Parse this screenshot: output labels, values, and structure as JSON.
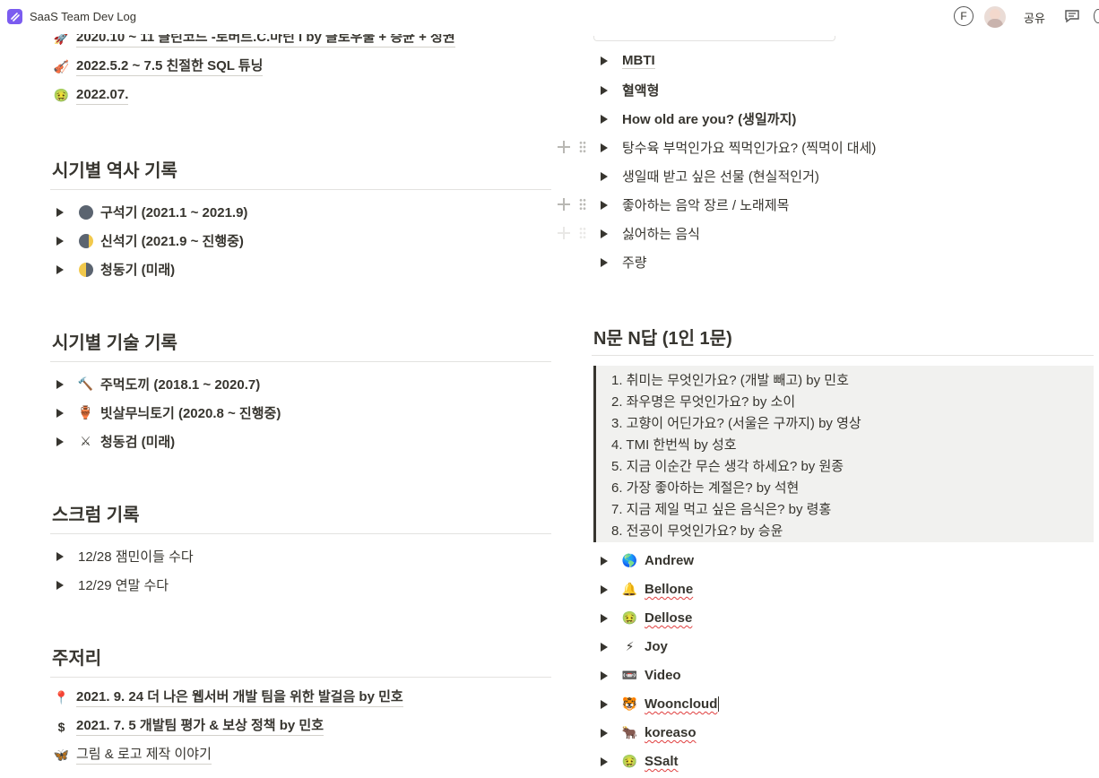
{
  "app": {
    "title": "SaaS Team Dev Log",
    "avatar_letter": "F",
    "share_label": "공유"
  },
  "left": {
    "top_links": [
      {
        "icon": "rocket-icon",
        "text": "2020.10 ~ 11 클린코드 -로버트.C.마틴 l by 클로우불 + 승균 + 정권"
      },
      {
        "icon": "violin-icon",
        "text": "2022.5.2 ~ 7.5 친절한 SQL 튜닝"
      },
      {
        "icon": "sick-face-icon",
        "text": "2022.07."
      }
    ],
    "history": {
      "heading": "시기별 역사 기록",
      "items": [
        {
          "icon": "new-moon-icon",
          "text": "구석기 (2021.1 ~ 2021.9)"
        },
        {
          "icon": "crescent-moon-icon",
          "text": "신석기 (2021.9 ~ 진행중)"
        },
        {
          "icon": "half-moon-icon",
          "text": "청동기 (미래)"
        }
      ]
    },
    "tech": {
      "heading": "시기별 기술 기록",
      "items": [
        {
          "icon": "hammer-icon",
          "text": "주먹도끼 (2018.1 ~ 2020.7)"
        },
        {
          "icon": "pottery-icon",
          "text": "빗살무늬토기 (2020.8 ~ 진행중)"
        },
        {
          "icon": "crossed-swords-icon",
          "text": "청동검 (미래)"
        }
      ]
    },
    "scrum": {
      "heading": "스크럼 기록",
      "items": [
        "12/28 잼민이들 수다",
        "12/29 연말 수다"
      ]
    },
    "ramble": {
      "heading": "주저리",
      "links": [
        {
          "icon": "pushpin-icon",
          "text": "2021. 9. 24 더 나은 웹서버 개발 팀을 위한 발걸음 by 민호"
        },
        {
          "icon": "dollar-icon",
          "text": "2021. 7. 5 개발팀 평가 & 보상 정책 by 민호"
        },
        {
          "icon": "butterfly-icon",
          "text": "그림 & 로고 제작 이야기"
        }
      ]
    }
  },
  "right": {
    "toggles": [
      {
        "text": "MBTI",
        "bold": true,
        "squig": false
      },
      {
        "text": "혈액형",
        "bold": true
      },
      {
        "text": "How old are you? (생일까지)",
        "bold": true
      },
      {
        "text": "탕수육 부먹인가요 찍먹인가요? (찍먹이 대세)",
        "bold": false
      },
      {
        "text": "생일때 받고 싶은 선물 (현실적인거)",
        "bold": false
      },
      {
        "text": "좋아하는 음악 장르 / 노래제목",
        "bold": false
      },
      {
        "text": "싫어하는 음식",
        "bold": false
      },
      {
        "text": "주량",
        "bold": false
      }
    ],
    "qa": {
      "heading": "N문 N답 (1인 1문)",
      "quote_lines": [
        "1. 취미는 무엇인가요? (개발 빼고) by 민호",
        "2. 좌우명은 무엇인가요? by 소이",
        "3. 고향이 어딘가요?  (서울은 구까지) by 영상",
        "4. TMI 한번씩 by 성호",
        "5. 지금 이순간 무슨 생각 하세요? by 원종",
        "6. 가장 좋아하는 계절은? by 석현",
        "7. 지금 제일 먹고 싶은 음식은? by 령홍",
        "8. 전공이 무엇인가요? by 승윤"
      ],
      "members": [
        {
          "icon": "globe-icon",
          "name": "Andrew",
          "squig": false
        },
        {
          "icon": "bell-icon",
          "name": "Bellone",
          "squig": true
        },
        {
          "icon": "sick-face-icon",
          "name": "Dellose",
          "squig": true
        },
        {
          "icon": "lightning-icon",
          "name": "Joy",
          "squig": false
        },
        {
          "icon": "vhs-icon",
          "name": "Video",
          "squig": false
        },
        {
          "icon": "tiger-icon",
          "name": "Wooncloud",
          "squig": true
        },
        {
          "icon": "ox-icon",
          "name": "koreaso",
          "squig": true
        },
        {
          "icon": "sick-face-icon",
          "name": "SSalt",
          "squig": true
        }
      ]
    }
  }
}
